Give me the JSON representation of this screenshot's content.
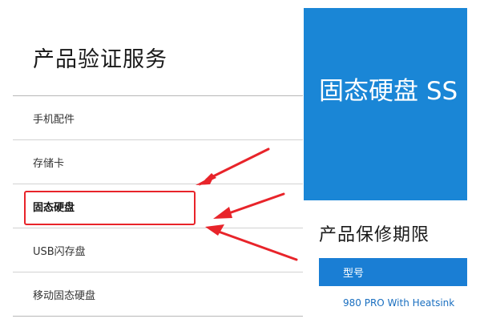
{
  "page": {
    "title": "产品验证服务"
  },
  "menu": {
    "items": [
      {
        "label": "手机配件",
        "active": false
      },
      {
        "label": "存储卡",
        "active": false
      },
      {
        "label": "固态硬盘",
        "active": true
      },
      {
        "label": "USB闪存盘",
        "active": false
      },
      {
        "label": "移动固态硬盘",
        "active": false
      }
    ]
  },
  "banner": {
    "title": "固态硬盘 SS"
  },
  "warranty": {
    "title": "产品保修期限",
    "table": {
      "header": "型号",
      "rows": [
        "980 PRO With Heatsink"
      ]
    }
  },
  "colors": {
    "accent": "#1a86d6",
    "highlight": "#e8242a",
    "link": "#1a6fc0"
  }
}
